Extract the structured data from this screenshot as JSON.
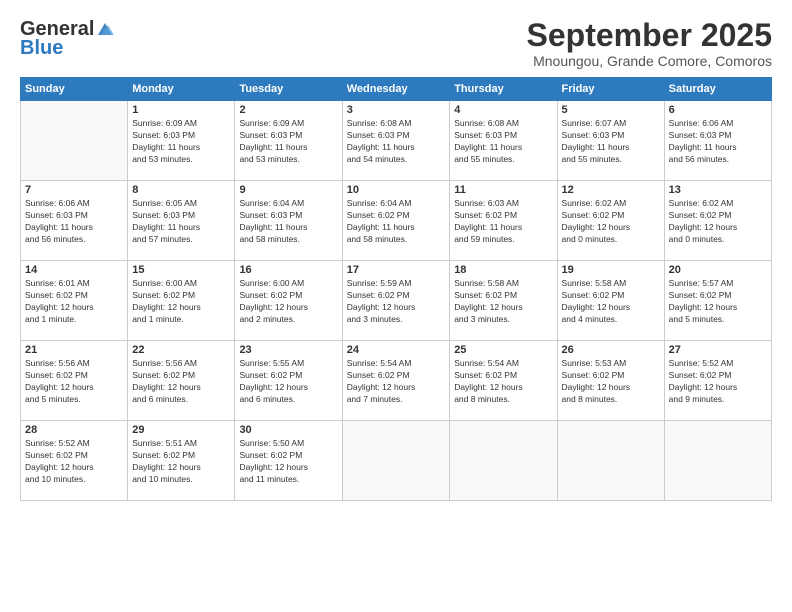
{
  "logo": {
    "line1": "General",
    "line2": "Blue"
  },
  "header": {
    "title": "September 2025",
    "location": "Mnoungou, Grande Comore, Comoros"
  },
  "calendar": {
    "days_of_week": [
      "Sunday",
      "Monday",
      "Tuesday",
      "Wednesday",
      "Thursday",
      "Friday",
      "Saturday"
    ],
    "weeks": [
      [
        {
          "day": "",
          "info": ""
        },
        {
          "day": "1",
          "info": "Sunrise: 6:09 AM\nSunset: 6:03 PM\nDaylight: 11 hours\nand 53 minutes."
        },
        {
          "day": "2",
          "info": "Sunrise: 6:09 AM\nSunset: 6:03 PM\nDaylight: 11 hours\nand 53 minutes."
        },
        {
          "day": "3",
          "info": "Sunrise: 6:08 AM\nSunset: 6:03 PM\nDaylight: 11 hours\nand 54 minutes."
        },
        {
          "day": "4",
          "info": "Sunrise: 6:08 AM\nSunset: 6:03 PM\nDaylight: 11 hours\nand 55 minutes."
        },
        {
          "day": "5",
          "info": "Sunrise: 6:07 AM\nSunset: 6:03 PM\nDaylight: 11 hours\nand 55 minutes."
        },
        {
          "day": "6",
          "info": "Sunrise: 6:06 AM\nSunset: 6:03 PM\nDaylight: 11 hours\nand 56 minutes."
        }
      ],
      [
        {
          "day": "7",
          "info": "Sunrise: 6:06 AM\nSunset: 6:03 PM\nDaylight: 11 hours\nand 56 minutes."
        },
        {
          "day": "8",
          "info": "Sunrise: 6:05 AM\nSunset: 6:03 PM\nDaylight: 11 hours\nand 57 minutes."
        },
        {
          "day": "9",
          "info": "Sunrise: 6:04 AM\nSunset: 6:03 PM\nDaylight: 11 hours\nand 58 minutes."
        },
        {
          "day": "10",
          "info": "Sunrise: 6:04 AM\nSunset: 6:02 PM\nDaylight: 11 hours\nand 58 minutes."
        },
        {
          "day": "11",
          "info": "Sunrise: 6:03 AM\nSunset: 6:02 PM\nDaylight: 11 hours\nand 59 minutes."
        },
        {
          "day": "12",
          "info": "Sunrise: 6:02 AM\nSunset: 6:02 PM\nDaylight: 12 hours\nand 0 minutes."
        },
        {
          "day": "13",
          "info": "Sunrise: 6:02 AM\nSunset: 6:02 PM\nDaylight: 12 hours\nand 0 minutes."
        }
      ],
      [
        {
          "day": "14",
          "info": "Sunrise: 6:01 AM\nSunset: 6:02 PM\nDaylight: 12 hours\nand 1 minute."
        },
        {
          "day": "15",
          "info": "Sunrise: 6:00 AM\nSunset: 6:02 PM\nDaylight: 12 hours\nand 1 minute."
        },
        {
          "day": "16",
          "info": "Sunrise: 6:00 AM\nSunset: 6:02 PM\nDaylight: 12 hours\nand 2 minutes."
        },
        {
          "day": "17",
          "info": "Sunrise: 5:59 AM\nSunset: 6:02 PM\nDaylight: 12 hours\nand 3 minutes."
        },
        {
          "day": "18",
          "info": "Sunrise: 5:58 AM\nSunset: 6:02 PM\nDaylight: 12 hours\nand 3 minutes."
        },
        {
          "day": "19",
          "info": "Sunrise: 5:58 AM\nSunset: 6:02 PM\nDaylight: 12 hours\nand 4 minutes."
        },
        {
          "day": "20",
          "info": "Sunrise: 5:57 AM\nSunset: 6:02 PM\nDaylight: 12 hours\nand 5 minutes."
        }
      ],
      [
        {
          "day": "21",
          "info": "Sunrise: 5:56 AM\nSunset: 6:02 PM\nDaylight: 12 hours\nand 5 minutes."
        },
        {
          "day": "22",
          "info": "Sunrise: 5:56 AM\nSunset: 6:02 PM\nDaylight: 12 hours\nand 6 minutes."
        },
        {
          "day": "23",
          "info": "Sunrise: 5:55 AM\nSunset: 6:02 PM\nDaylight: 12 hours\nand 6 minutes."
        },
        {
          "day": "24",
          "info": "Sunrise: 5:54 AM\nSunset: 6:02 PM\nDaylight: 12 hours\nand 7 minutes."
        },
        {
          "day": "25",
          "info": "Sunrise: 5:54 AM\nSunset: 6:02 PM\nDaylight: 12 hours\nand 8 minutes."
        },
        {
          "day": "26",
          "info": "Sunrise: 5:53 AM\nSunset: 6:02 PM\nDaylight: 12 hours\nand 8 minutes."
        },
        {
          "day": "27",
          "info": "Sunrise: 5:52 AM\nSunset: 6:02 PM\nDaylight: 12 hours\nand 9 minutes."
        }
      ],
      [
        {
          "day": "28",
          "info": "Sunrise: 5:52 AM\nSunset: 6:02 PM\nDaylight: 12 hours\nand 10 minutes."
        },
        {
          "day": "29",
          "info": "Sunrise: 5:51 AM\nSunset: 6:02 PM\nDaylight: 12 hours\nand 10 minutes."
        },
        {
          "day": "30",
          "info": "Sunrise: 5:50 AM\nSunset: 6:02 PM\nDaylight: 12 hours\nand 11 minutes."
        },
        {
          "day": "",
          "info": ""
        },
        {
          "day": "",
          "info": ""
        },
        {
          "day": "",
          "info": ""
        },
        {
          "day": "",
          "info": ""
        }
      ]
    ]
  }
}
